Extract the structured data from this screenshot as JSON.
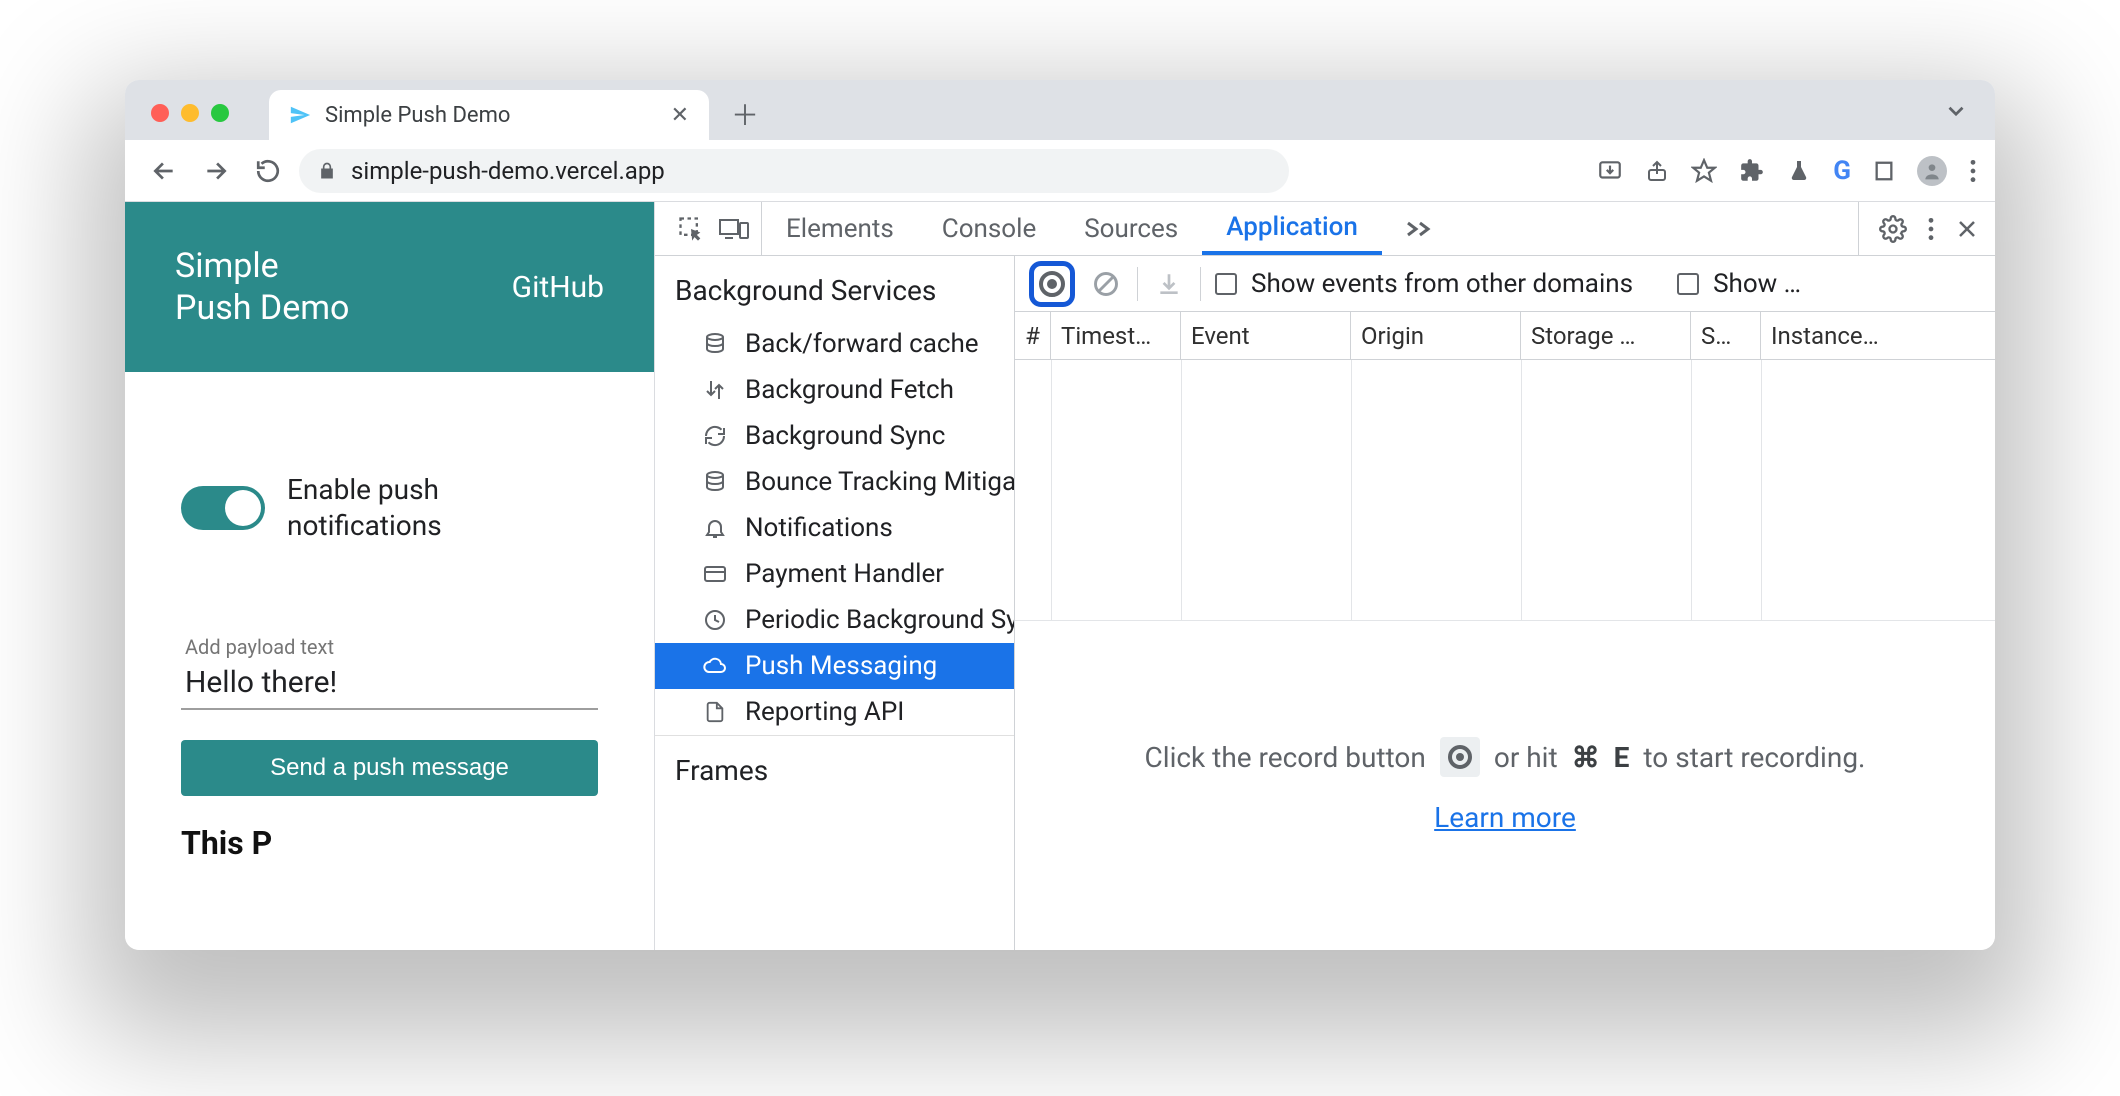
{
  "browser": {
    "tab_title": "Simple Push Demo",
    "url": "simple-push-demo.vercel.app"
  },
  "page": {
    "title_line1": "Simple",
    "title_line2": "Push Demo",
    "github_link": "GitHub",
    "toggle_label_line1": "Enable push",
    "toggle_label_line2": "notifications",
    "payload_placeholder": "Add payload text",
    "payload_value": "Hello there!",
    "send_button": "Send a push message",
    "truncated_heading": "This Browser"
  },
  "devtools": {
    "tabs": {
      "elements": "Elements",
      "console": "Console",
      "sources": "Sources",
      "application": "Application"
    },
    "sidebar": {
      "section_bg": "Background Services",
      "items": [
        "Back/forward cache",
        "Background Fetch",
        "Background Sync",
        "Bounce Tracking Mitigations",
        "Notifications",
        "Payment Handler",
        "Periodic Background Sync",
        "Push Messaging",
        "Reporting API"
      ],
      "section_frames": "Frames"
    },
    "toolbar": {
      "show_other": "Show events from other domains",
      "show_trunc": "Show …"
    },
    "columns": {
      "num": "#",
      "timestamp": "Timest…",
      "event": "Event",
      "origin": "Origin",
      "storage": "Storage …",
      "s": "S…",
      "instance": "Instance…"
    },
    "empty": {
      "before": "Click the record button",
      "after1": "or hit",
      "shortcut_sym": "⌘",
      "shortcut_key": "E",
      "after2": "to start recording.",
      "learn_more": "Learn more"
    }
  }
}
